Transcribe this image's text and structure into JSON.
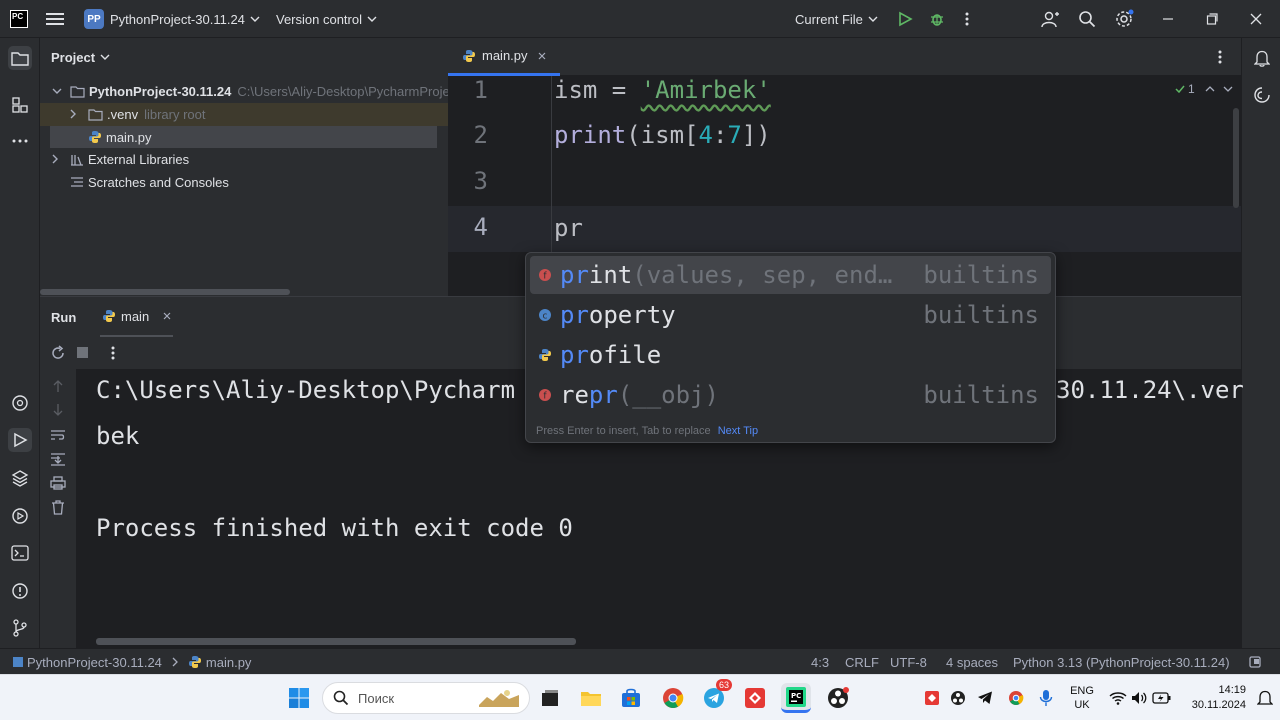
{
  "titlebar": {
    "project_badge": "PP",
    "project_name": "PythonProject-30.11.24",
    "vcs": "Version control",
    "run_config": "Current File"
  },
  "project_panel": {
    "title": "Project",
    "tree": [
      {
        "label": "PythonProject-30.11.24",
        "hint": "C:\\Users\\Aliy-Desktop\\PycharmProje"
      },
      {
        "label": ".venv",
        "hint": "library root"
      },
      {
        "label": "main.py",
        "hint": ""
      },
      {
        "label": "External Libraries",
        "hint": ""
      },
      {
        "label": "Scratches and Consoles",
        "hint": ""
      }
    ]
  },
  "editor": {
    "tab": "main.py",
    "inspection_count": "1",
    "lines": [
      "1",
      "2",
      "3",
      "4"
    ],
    "code": {
      "l1_var": "ism",
      "l1_eq": " = ",
      "l1_str": "'Amirbek'",
      "l2_fn": "print",
      "l2_a": "(ism[",
      "l2_n1": "4",
      "l2_colon": ":",
      "l2_n2": "7",
      "l2_b": "])",
      "l4": "pr"
    }
  },
  "completion": {
    "items": [
      {
        "match": "pr",
        "rest": "int",
        "params": "(values, sep, end…",
        "source": "builtins"
      },
      {
        "match": "pr",
        "rest": "operty",
        "params": "",
        "source": "builtins"
      },
      {
        "match": "pr",
        "rest": "ofile",
        "params": "",
        "source": ""
      },
      {
        "pre": "re",
        "match": "pr",
        "params": "(__obj)",
        "source": "builtins"
      }
    ],
    "footer": "Press Enter to insert, Tab to replace",
    "next_tip": "Next Tip"
  },
  "run_panel": {
    "title": "Run",
    "tab": "main",
    "console": [
      "C:\\Users\\Aliy-Desktop\\Pycharm",
      "30.11.24\\.ver",
      "bek",
      "Process finished with exit code 0"
    ]
  },
  "statusbar": {
    "breadcrumb_project": "PythonProject-30.11.24",
    "breadcrumb_file": "main.py",
    "position": "4:3",
    "line_sep": "CRLF",
    "encoding": "UTF-8",
    "indent": "4 spaces",
    "interpreter": "Python 3.13 (PythonProject-30.11.24)"
  },
  "taskbar": {
    "search_placeholder": "Поиск",
    "telegram_badge": "63",
    "lang": "ENG",
    "layout": "UK",
    "time": "14:19",
    "date": "30.11.2024"
  },
  "colors": {
    "accent": "#3574f0",
    "string": "#6aab73",
    "number": "#2aacb8",
    "function": "#b3aedc",
    "match": "#548af7"
  }
}
